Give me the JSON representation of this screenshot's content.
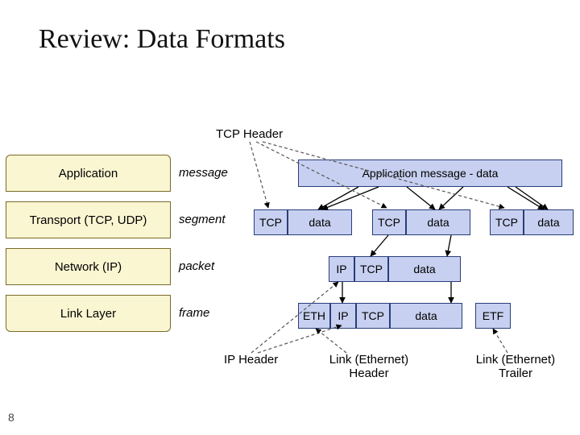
{
  "title": "Review: Data Formats",
  "slide_number": "8",
  "annotations": {
    "tcp_header": "TCP Header",
    "ip_header": "IP Header",
    "link_header": "Link (Ethernet)\nHeader",
    "link_trailer": "Link (Ethernet)\nTrailer",
    "app_msg_data": "Application message - data"
  },
  "layers": [
    {
      "name": "Application",
      "unit": "message"
    },
    {
      "name": "Transport (TCP, UDP)",
      "unit": "segment"
    },
    {
      "name": "Network (IP)",
      "unit": "packet"
    },
    {
      "name": "Link Layer",
      "unit": "frame"
    }
  ],
  "cells": {
    "app_data": "Application message - data",
    "tcp": "TCP",
    "data": "data",
    "ip": "IP",
    "eth": "ETH",
    "etf": "ETF"
  }
}
